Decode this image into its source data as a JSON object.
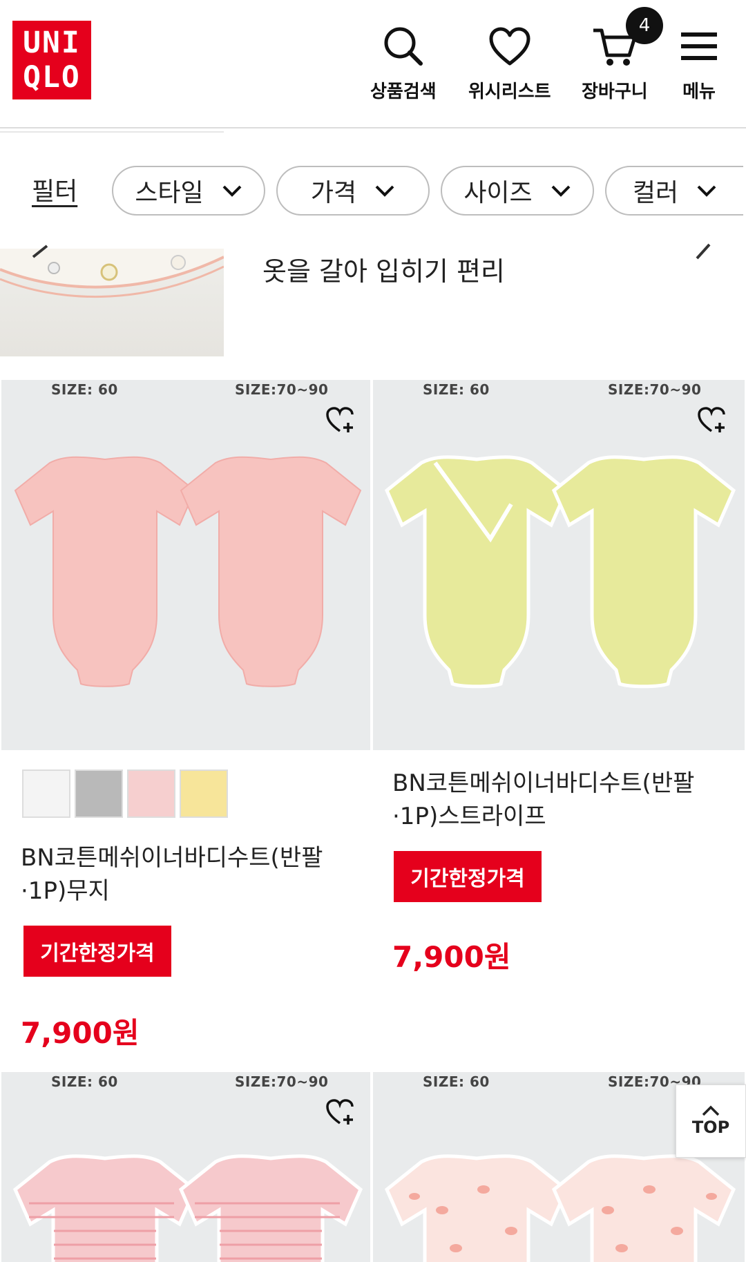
{
  "header": {
    "logo_line1": "UNI",
    "logo_line2": "QLO",
    "search_label": "상품검색",
    "wishlist_label": "위시리스트",
    "cart_label": "장바구니",
    "cart_count": "4",
    "menu_label": "메뉴"
  },
  "filters": {
    "label": "필터",
    "chips": [
      "스타일",
      "가격",
      "사이즈",
      "컬러"
    ]
  },
  "strip": {
    "text": "옷을 갈아 입히기 편리"
  },
  "products": [
    {
      "size_left": "SIZE: 60",
      "size_right": "SIZE:70~90",
      "swatches": [
        "#f4f4f4",
        "#b9b9b9",
        "#f6cfcf",
        "#f7e59a"
      ],
      "name": "BN코튼메쉬이너바디수트(반팔·1P)무지",
      "badge": "기간한정가격",
      "price": "7,900원",
      "color": "#f7c3bf"
    },
    {
      "size_left": "SIZE: 60",
      "size_right": "SIZE:70~90",
      "name": "BN코튼메쉬이너바디수트(반팔·1P)스트라이프",
      "badge": "기간한정가격",
      "price": "7,900원",
      "color": "#e7ea9b"
    },
    {
      "size_left": "SIZE: 60",
      "size_right": "SIZE:70~90",
      "color": "#f6c9cc"
    },
    {
      "size_left": "SIZE: 60",
      "size_right": "SIZE:70~90",
      "color": "#fbe4df"
    }
  ],
  "top_button": "TOP"
}
